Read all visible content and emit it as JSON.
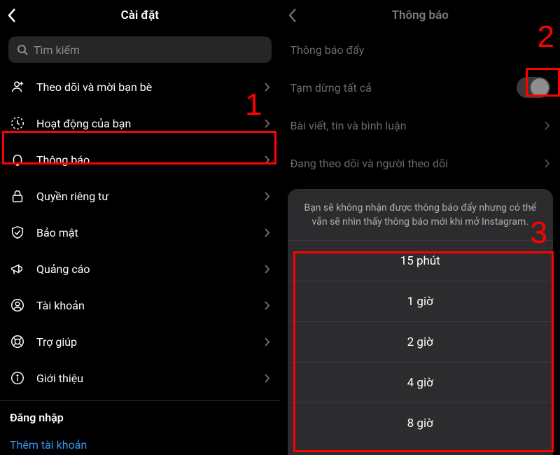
{
  "left": {
    "header": {
      "title": "Cài đặt"
    },
    "search": {
      "placeholder": "Tìm kiếm"
    },
    "menu": [
      {
        "key": "invite",
        "label": "Theo dõi và mời bạn bè",
        "icon": "person-plus-icon"
      },
      {
        "key": "activity",
        "label": "Hoạt động của bạn",
        "icon": "clock-icon"
      },
      {
        "key": "notifs",
        "label": "Thông báo",
        "icon": "bell-icon"
      },
      {
        "key": "privacy",
        "label": "Quyền riêng tư",
        "icon": "lock-icon"
      },
      {
        "key": "security",
        "label": "Bảo mật",
        "icon": "shield-icon"
      },
      {
        "key": "ads",
        "label": "Quảng cáo",
        "icon": "megaphone-icon"
      },
      {
        "key": "account",
        "label": "Tài khoản",
        "icon": "user-icon"
      },
      {
        "key": "help",
        "label": "Trợ giúp",
        "icon": "lifebuoy-icon"
      },
      {
        "key": "about",
        "label": "Giới thiệu",
        "icon": "info-icon"
      }
    ],
    "login_section": "Đăng nhập",
    "add_account": "Thêm tài khoản"
  },
  "right": {
    "header": {
      "title": "Thông báo"
    },
    "rows": {
      "push": "Thông báo đẩy",
      "pause": "Tạm dừng tất cả",
      "posts": "Bài viết, tin và bình luận",
      "follows": "Đang theo dõi và người theo dõi"
    },
    "sheet": {
      "desc": "Bạn sẽ không nhận được thông báo đẩy nhưng có thể vẫn sẽ nhìn thấy thông báo mới khi mở Instagram.",
      "options": [
        "15 phút",
        "1 giờ",
        "2 giờ",
        "4 giờ",
        "8 giờ"
      ]
    }
  },
  "annotations": {
    "n1": "1",
    "n2": "2",
    "n3": "3"
  }
}
